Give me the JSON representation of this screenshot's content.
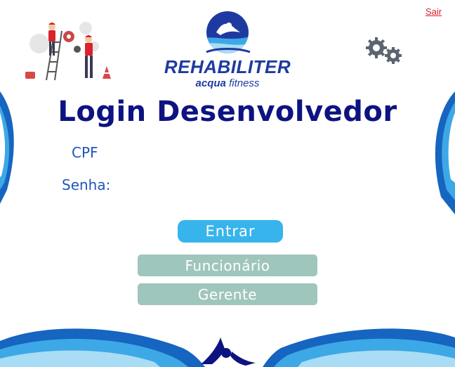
{
  "header": {
    "exit_link": "Sair"
  },
  "brand": {
    "name": "REHABILITER",
    "tagline_bold": "acqua",
    "tagline_rest": " fitness"
  },
  "page_title": "Login Desenvolvedor",
  "form": {
    "cpf_label": "CPF",
    "cpf_value": "",
    "senha_label": "Senha:",
    "senha_value": ""
  },
  "buttons": {
    "entrar": "Entrar",
    "funcionario": "Funcionário",
    "gerente": "Gerente"
  },
  "icons": {
    "top_left": "maintenance-workers-illustration-icon",
    "top_right": "gears-icon",
    "brand": "swimmer-logo-icon",
    "bottom": "swimmer-silhouette-icon"
  },
  "colors": {
    "title": "#0d1380",
    "label": "#2056b8",
    "primary_button": "#38b4ec",
    "secondary_button": "#9fc6bc",
    "exit_link": "#d9232e",
    "wave_dark": "#1665c0",
    "wave_light": "#3da8e6"
  }
}
